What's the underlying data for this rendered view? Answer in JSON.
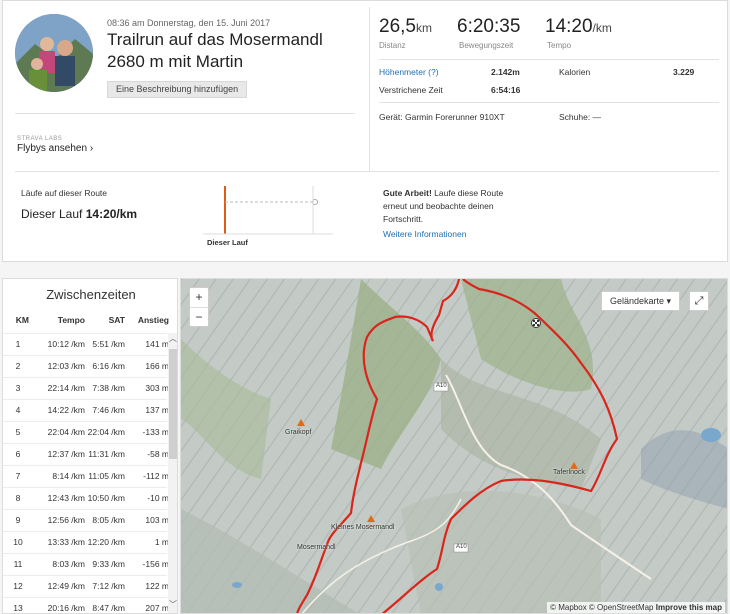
{
  "activity": {
    "datetime": "08:36 am Donnerstag, den 15. Juni 2017",
    "title": "Trailrun auf das Mosermandl 2680 m mit Martin",
    "add_description": "Eine Beschreibung hinzufügen"
  },
  "labs": {
    "tag": "STRAVA LABS",
    "flybys": "Flybys ansehen ›"
  },
  "stats": {
    "distance": {
      "value": "26,5",
      "unit": "km",
      "label": "Distanz"
    },
    "moving_time": {
      "value": "6:20:35",
      "label": "Bewegungszeit"
    },
    "pace": {
      "value": "14:20",
      "unit": "/km",
      "label": "Tempo"
    }
  },
  "details": {
    "elevation_label": "Höhenmeter (?)",
    "elevation_value": "2.142m",
    "calories_label": "Kalorien",
    "calories_value": "3.229",
    "elapsed_label": "Verstrichene Zeit",
    "elapsed_value": "6:54:16",
    "device": "Gerät: Garmin Forerunner 910XT",
    "shoes": "Schuhe: —"
  },
  "route": {
    "label": "Läufe auf dieser Route",
    "value_prefix": "Dieser Lauf",
    "value": "14:20/km",
    "chart_label": "Dieser Lauf",
    "good_work": "Gute Arbeit!",
    "good_text": "Laufe diese Route erneut und beobachte deinen Fortschritt.",
    "more_info": "Weitere Informationen"
  },
  "splits": {
    "title": "Zwischenzeiten",
    "headers": [
      "KM",
      "Tempo",
      "SAT",
      "Anstieg"
    ],
    "rows": [
      [
        "1",
        "10:12 /km",
        "5:51 /km",
        "141 m"
      ],
      [
        "2",
        "12:03 /km",
        "6:16 /km",
        "166 m"
      ],
      [
        "3",
        "22:14 /km",
        "7:38 /km",
        "303 m"
      ],
      [
        "4",
        "14:22 /km",
        "7:46 /km",
        "137 m"
      ],
      [
        "5",
        "22:04 /km",
        "22:04 /km",
        "-133 m"
      ],
      [
        "6",
        "12:37 /km",
        "11:31 /km",
        "-58 m"
      ],
      [
        "7",
        "8:14 /km",
        "11:05 /km",
        "-112 m"
      ],
      [
        "8",
        "12:43 /km",
        "10:50 /km",
        "-10 m"
      ],
      [
        "9",
        "12:56 /km",
        "8:05 /km",
        "103 m"
      ],
      [
        "10",
        "13:33 /km",
        "12:20 /km",
        "1 m"
      ],
      [
        "11",
        "8:03 /km",
        "9:33 /km",
        "-156 m"
      ],
      [
        "12",
        "12:49 /km",
        "7:12 /km",
        "122 m"
      ],
      [
        "13",
        "20:16 /km",
        "8:47 /km",
        "207 m"
      ]
    ]
  },
  "map": {
    "zoom_in": "+",
    "zoom_out": "−",
    "type_select": "Geländekarte ▾",
    "fullscreen": "⤢",
    "attribution_a": "© Mapbox © OpenStreetMap",
    "attribution_b": "Improve this map",
    "labels": {
      "graikopf": "Graikopf",
      "kleines": "Kleines Mosermandl",
      "mosermandl": "Mosermandl",
      "taferlnock": "Taferlnock",
      "a10_1": "A10",
      "a10_2": "A10"
    },
    "route_color": "#d9251c"
  }
}
